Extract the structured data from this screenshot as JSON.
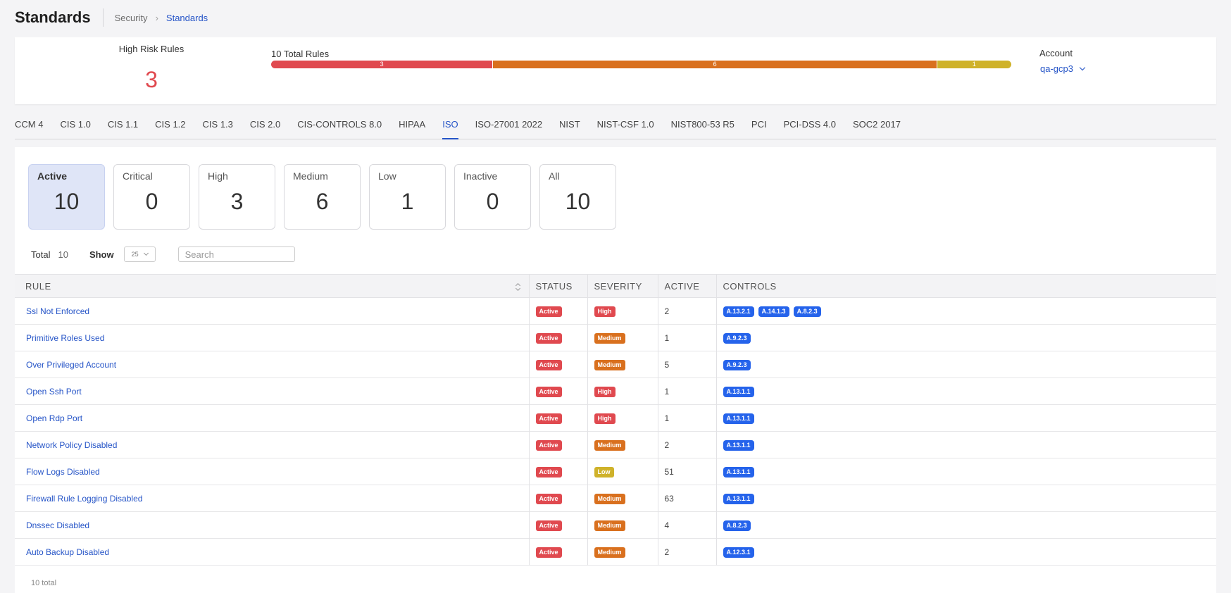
{
  "header": {
    "title": "Standards",
    "breadcrumb": [
      "Security",
      "Standards"
    ]
  },
  "summary": {
    "high_risk_label": "High Risk Rules",
    "high_risk_value": "3",
    "total_rules_label": "10 Total Rules",
    "bar": [
      {
        "severity": "high",
        "count": 3,
        "color": "#e0494f"
      },
      {
        "severity": "medium",
        "count": 6,
        "color": "#d9701e"
      },
      {
        "severity": "low",
        "count": 1,
        "color": "#cfb22a"
      }
    ],
    "account_label": "Account",
    "account_value": "qa-gcp3"
  },
  "tabs": [
    "CCM 4",
    "CIS 1.0",
    "CIS 1.1",
    "CIS 1.2",
    "CIS 1.3",
    "CIS 2.0",
    "CIS-CONTROLS 8.0",
    "HIPAA",
    "ISO",
    "ISO-27001 2022",
    "NIST",
    "NIST-CSF 1.0",
    "NIST800-53 R5",
    "PCI",
    "PCI-DSS 4.0",
    "SOC2 2017"
  ],
  "active_tab": "ISO",
  "cards": [
    {
      "label": "Active",
      "value": "10",
      "active": true
    },
    {
      "label": "Critical",
      "value": "0"
    },
    {
      "label": "High",
      "value": "3"
    },
    {
      "label": "Medium",
      "value": "6"
    },
    {
      "label": "Low",
      "value": "1"
    },
    {
      "label": "Inactive",
      "value": "0"
    },
    {
      "label": "All",
      "value": "10"
    }
  ],
  "controls": {
    "total_label": "Total",
    "total_value": "10",
    "show_label": "Show",
    "show_value": "25",
    "search_placeholder": "Search"
  },
  "table": {
    "headers": {
      "rule": "RULE",
      "status": "STATUS",
      "severity": "SEVERITY",
      "active": "ACTIVE",
      "controls": "CONTROLS"
    },
    "rows": [
      {
        "rule": "Ssl Not Enforced",
        "status": "Active",
        "severity": "High",
        "active": "2",
        "controls": [
          "A.13.2.1",
          "A.14.1.3",
          "A.8.2.3"
        ]
      },
      {
        "rule": "Primitive Roles Used",
        "status": "Active",
        "severity": "Medium",
        "active": "1",
        "controls": [
          "A.9.2.3"
        ]
      },
      {
        "rule": "Over Privileged Account",
        "status": "Active",
        "severity": "Medium",
        "active": "5",
        "controls": [
          "A.9.2.3"
        ]
      },
      {
        "rule": "Open Ssh Port",
        "status": "Active",
        "severity": "High",
        "active": "1",
        "controls": [
          "A.13.1.1"
        ]
      },
      {
        "rule": "Open Rdp Port",
        "status": "Active",
        "severity": "High",
        "active": "1",
        "controls": [
          "A.13.1.1"
        ]
      },
      {
        "rule": "Network Policy Disabled",
        "status": "Active",
        "severity": "Medium",
        "active": "2",
        "controls": [
          "A.13.1.1"
        ]
      },
      {
        "rule": "Flow Logs Disabled",
        "status": "Active",
        "severity": "Low",
        "active": "51",
        "controls": [
          "A.13.1.1"
        ]
      },
      {
        "rule": "Firewall Rule Logging Disabled",
        "status": "Active",
        "severity": "Medium",
        "active": "63",
        "controls": [
          "A.13.1.1"
        ]
      },
      {
        "rule": "Dnssec Disabled",
        "status": "Active",
        "severity": "Medium",
        "active": "4",
        "controls": [
          "A.8.2.3"
        ]
      },
      {
        "rule": "Auto Backup Disabled",
        "status": "Active",
        "severity": "Medium",
        "active": "2",
        "controls": [
          "A.12.3.1"
        ]
      }
    ]
  },
  "footer": {
    "total_text": "10 total"
  },
  "colors": {
    "accent": "#2554c7",
    "high": "#e0494f",
    "medium": "#d9701e",
    "low": "#cfb22a",
    "control_badge": "#2563eb"
  }
}
